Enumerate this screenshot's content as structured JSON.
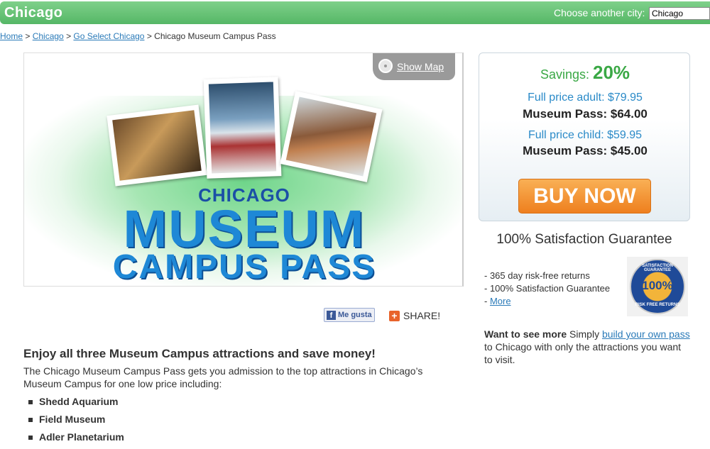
{
  "header": {
    "city": "Chicago",
    "choose_label": "Choose another city:",
    "city_input_value": "Chicago"
  },
  "breadcrumb": {
    "home": "Home",
    "sep": " > ",
    "chicago": "Chicago",
    "go_select": "Go Select Chicago",
    "current": "Chicago Museum Campus Pass"
  },
  "hero": {
    "show_map": "Show Map",
    "logo_line1": "CHICAGO",
    "logo_line2": "MUSEUM",
    "logo_line3": "CAMPUS PASS"
  },
  "social": {
    "like_label": "Me gusta",
    "share_label": "SHARE!"
  },
  "content": {
    "heading": "Enjoy all three Museum Campus attractions and save money!",
    "description": "The Chicago Museum Campus Pass gets you admission to the top attractions in Chicago’s Museum Campus for one low price including:",
    "attractions": [
      "Shedd Aquarium",
      "Field Museum",
      "Adler Planetarium"
    ]
  },
  "pricing": {
    "savings_label": "Savings:",
    "savings_pct": "20%",
    "adult_full": "Full price adult: $79.95",
    "adult_pass": "Museum Pass: $64.00",
    "child_full": "Full price child: $59.95",
    "child_pass": "Museum Pass: $45.00",
    "buy_label": "BUY NOW"
  },
  "guarantee": {
    "title": "100% Satisfaction Guarantee",
    "items": [
      "- 365 day risk-free returns",
      "- 100% Satisfaction Guarantee"
    ],
    "more_prefix": "- ",
    "more_link": "More",
    "seal_pct": "100%",
    "seal_top": "SATISFACTION GUARANTEE",
    "seal_bottom": "RISK FREE RETURNS"
  },
  "see_more": {
    "bold": "Want to see more",
    "text1": " Simply ",
    "link": "build your own pass",
    "text2": " to Chicago with only the attractions you want to visit."
  },
  "colors": {
    "header_green": "#55b766",
    "link_blue": "#2a7ab8",
    "savings_green": "#3aa845",
    "buy_orange": "#ee7f1e"
  }
}
